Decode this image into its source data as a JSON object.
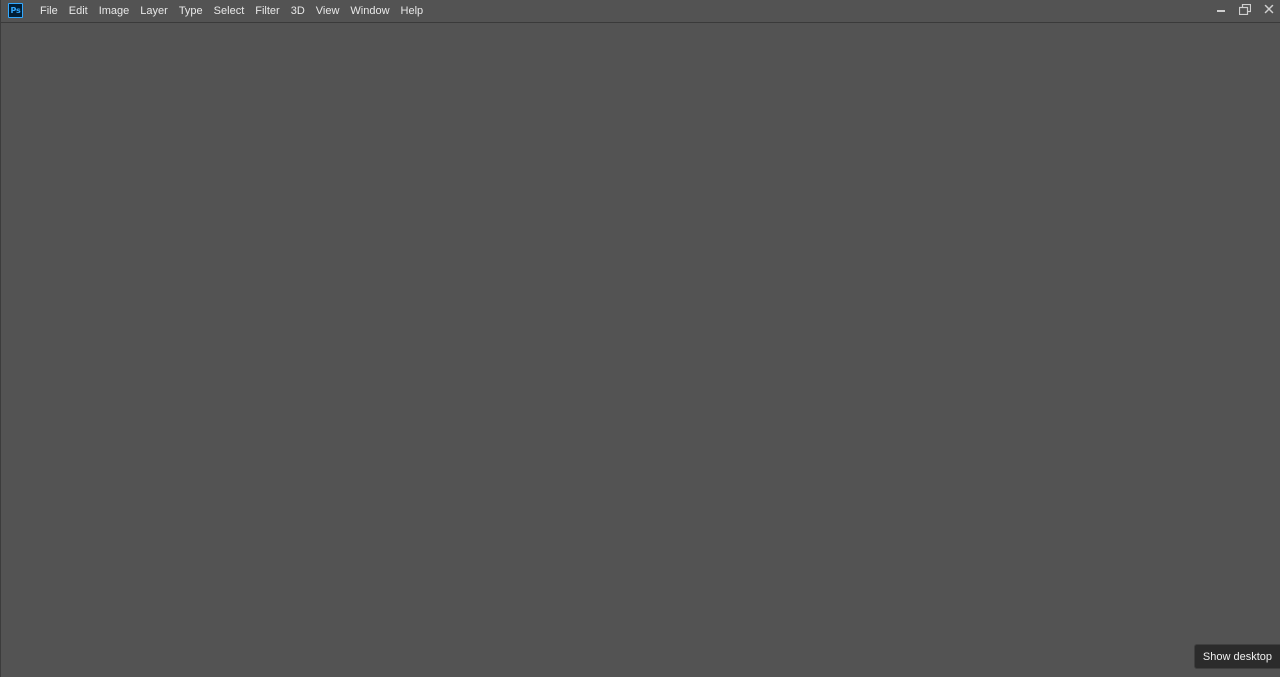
{
  "app": {
    "logo_text": "Ps",
    "logo_color": "#31a8ff",
    "logo_bg": "#001e36"
  },
  "menu": {
    "items": [
      {
        "label": "File"
      },
      {
        "label": "Edit"
      },
      {
        "label": "Image"
      },
      {
        "label": "Layer"
      },
      {
        "label": "Type"
      },
      {
        "label": "Select"
      },
      {
        "label": "Filter"
      },
      {
        "label": "3D"
      },
      {
        "label": "View"
      },
      {
        "label": "Window"
      },
      {
        "label": "Help"
      }
    ]
  },
  "window_controls": {
    "minimize_icon": "minimize-icon",
    "restore_icon": "restore-icon",
    "close_icon": "close-icon"
  },
  "tooltip": {
    "text": "Show desktop"
  },
  "colors": {
    "workspace": "#535353",
    "text": "#e8e8e8"
  }
}
